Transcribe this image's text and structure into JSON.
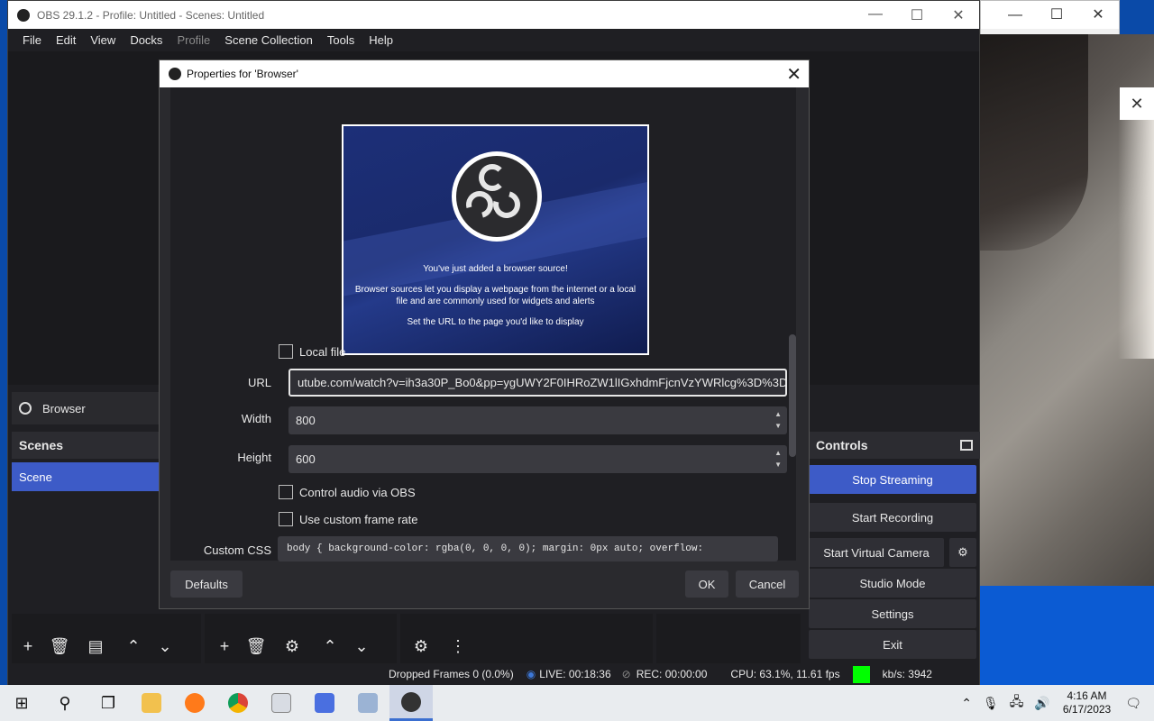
{
  "obs_window": {
    "title": "OBS 29.1.2 - Profile: Untitled - Scenes: Untitled",
    "minimize": "—",
    "maximize": "☐",
    "close": "✕"
  },
  "menu": [
    "File",
    "Edit",
    "View",
    "Docks",
    "Profile",
    "Scene Collection",
    "Tools",
    "Help"
  ],
  "source_bar": {
    "label": "Browser"
  },
  "scenes": {
    "header": "Scenes",
    "items": [
      "Scene"
    ]
  },
  "controls": {
    "header": "Controls",
    "stop_streaming": "Stop Streaming",
    "start_recording": "Start Recording",
    "start_virtual_camera": "Start Virtual Camera",
    "studio_mode": "Studio Mode",
    "settings": "Settings",
    "exit": "Exit"
  },
  "status": {
    "dropped_frames": "Dropped Frames 0 (0.0%)",
    "live": "LIVE: 00:18:36",
    "rec": "REC: 00:00:00",
    "cpu": "CPU: 63.1%, 11.61 fps",
    "kbps": "kb/s: 3942",
    "indicator_color": "#00ff00"
  },
  "dialog": {
    "title": "Properties for 'Browser'",
    "close": "✕",
    "preview": {
      "line1": "You've just added a browser source!",
      "line2": "Browser sources let you display a webpage from the internet or a local file and are commonly used for widgets and alerts",
      "line3": "Set the URL to the page you'd like to display"
    },
    "local_file_label": "Local file",
    "url_label": "URL",
    "url_value": "utube.com/watch?v=ih3a30P_Bo0&pp=ygUWY2F0IHRoZW1lIGxhdmFjcnVzYWRlcg%3D%3D",
    "width_label": "Width",
    "width_value": "800",
    "height_label": "Height",
    "height_value": "600",
    "control_audio_label": "Control audio via OBS",
    "custom_frame_rate_label": "Use custom frame rate",
    "custom_css_label": "Custom CSS",
    "custom_css_value": "body { background-color: rgba(0, 0, 0, 0); margin: 0px auto; overflow:",
    "defaults_btn": "Defaults",
    "ok_btn": "OK",
    "cancel_btn": "Cancel"
  },
  "taskbar": {
    "clock_time": "4:16 AM",
    "clock_date": "6/17/2023"
  }
}
